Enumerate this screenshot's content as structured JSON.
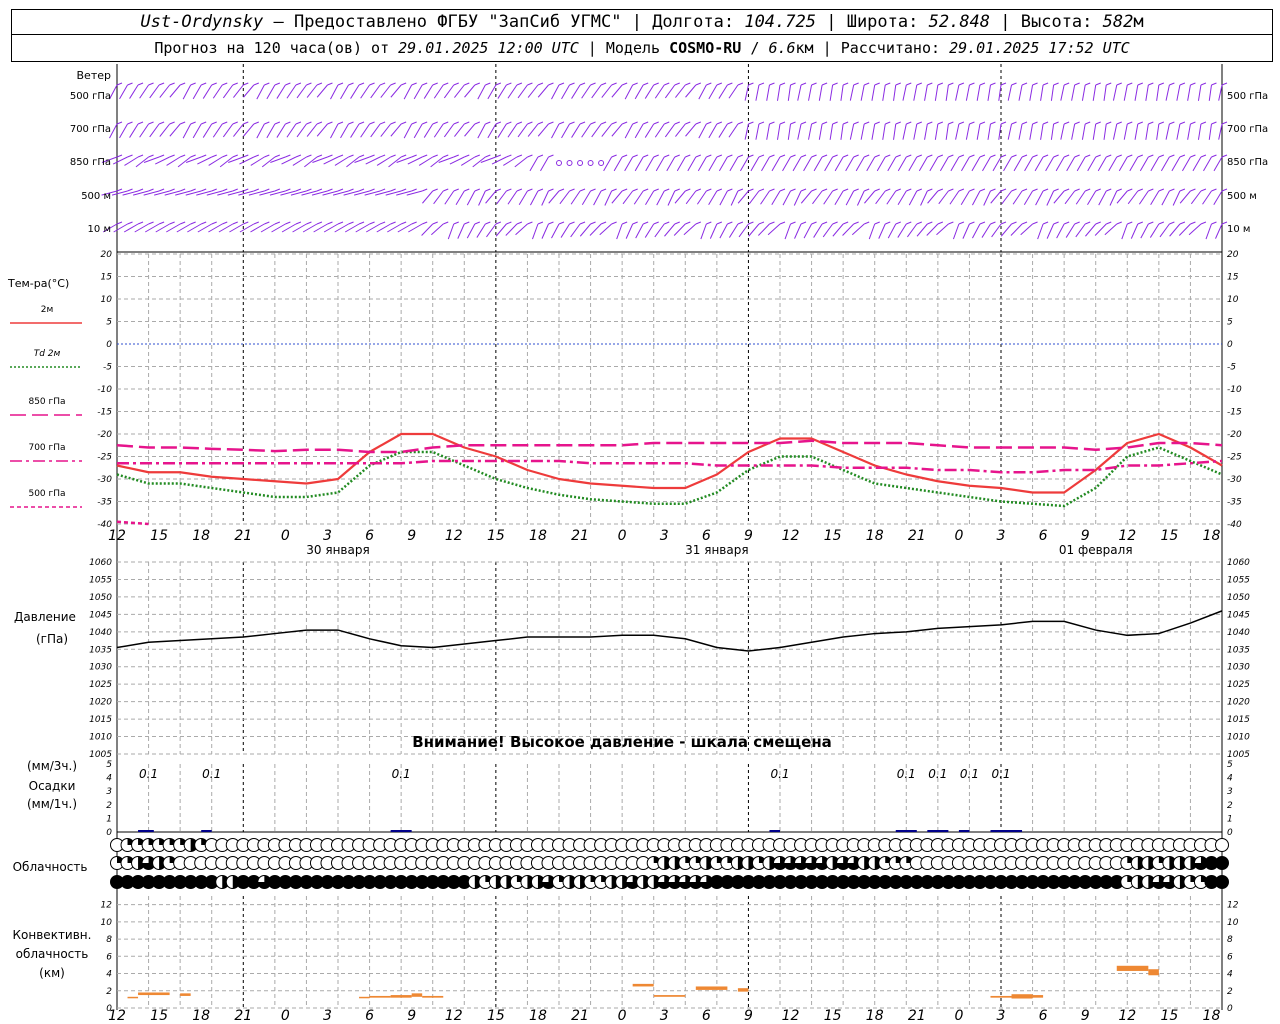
{
  "header": {
    "station": "Ust-Ordynsky",
    "dash": "—",
    "provider": "Предоставлено ФГБУ \"ЗапСиб УГМС\"",
    "lon_label": "Долгота:",
    "lon_value": "104.725",
    "lat_label": "Широта:",
    "lat_value": "52.848",
    "alt_label": "Высота:",
    "alt_value": "582",
    "alt_unit": "м",
    "forecast_prefix": "Прогноз на 120 часа(ов) от",
    "forecast_time": "29.01.2025 12:00 UTC",
    "model_label": "Модель",
    "model_name": "COSMO-RU",
    "model_res": "6.6",
    "model_res_unit": "км",
    "calc_label": "Рассчитано:",
    "calc_time": "29.01.2025 17:52 UTC"
  },
  "colors": {
    "wind": "#8a2be2",
    "t2m": "#ee3b3b",
    "td2m": "#228b22",
    "t850": "#e6148c",
    "pressure": "#000000",
    "precip": "#00008b",
    "conv": "#ee8833",
    "zero_line": "#2f4fcf",
    "grid": "#aaaaaa"
  },
  "time_axis": {
    "hour_labels": [
      "12",
      "15",
      "18",
      "21",
      "0",
      "3",
      "6",
      "9",
      "12",
      "15",
      "18",
      "21",
      "0",
      "3",
      "6",
      "9",
      "12",
      "15",
      "18",
      "21",
      "0",
      "3",
      "6",
      "9",
      "12",
      "15",
      "18"
    ],
    "day_labels": [
      {
        "text": "30 января",
        "hour": 21
      },
      {
        "text": "31 января",
        "hour": 57
      },
      {
        "text": "01 февраля",
        "hour": 93
      }
    ]
  },
  "wind_panel": {
    "title": "Ветер",
    "levels": [
      "500 гПа",
      "700 гПа",
      "850 гПа",
      "500 м",
      "10  м"
    ]
  },
  "chart_data": [
    {
      "type": "line",
      "name": "temperature",
      "label": "Тем-ра(°C)",
      "ylim": [
        -40,
        20
      ],
      "yticks": [
        20,
        15,
        10,
        5,
        0,
        -5,
        -10,
        -15,
        -20,
        -25,
        -30,
        -35,
        -40
      ],
      "x_hours": [
        0,
        3,
        6,
        9,
        12,
        15,
        18,
        21,
        24,
        27,
        30,
        33,
        36,
        39,
        42,
        45,
        48,
        51,
        54,
        57,
        60,
        63,
        66,
        69,
        72,
        75,
        78,
        81,
        84,
        87,
        90,
        93,
        96,
        99,
        102,
        105
      ],
      "series": [
        {
          "name": "2м",
          "style": "solid",
          "values": [
            -27,
            -28.5,
            -28.5,
            -29.5,
            -30,
            -30.5,
            -31,
            -30,
            -24,
            -20,
            -20,
            -23,
            -25,
            -28,
            -30,
            -31,
            -31.5,
            -32,
            -32,
            -29,
            -24,
            -21,
            -21,
            -24,
            -27,
            -29,
            -30.5,
            -31.5,
            -32,
            -33,
            -33,
            -28,
            -22,
            -20,
            -23,
            -27
          ]
        },
        {
          "name": "Td  2м",
          "style": "dotted",
          "values": [
            -29,
            -31,
            -31,
            -32,
            -33,
            -34,
            -34,
            -33,
            -27,
            -24,
            -24,
            -27,
            -30,
            -32,
            -33.5,
            -34.5,
            -35,
            -35.5,
            -35.5,
            -33,
            -28,
            -25,
            -25,
            -28,
            -31,
            -32,
            -33,
            -34,
            -35,
            -35.5,
            -36,
            -32,
            -25,
            -23,
            -26,
            -29
          ]
        },
        {
          "name": "850 гПа",
          "style": "dashed",
          "values": [
            -22.5,
            -23,
            -23,
            -23.3,
            -23.5,
            -23.8,
            -23.5,
            -23.5,
            -24,
            -24,
            -23,
            -22.5,
            -22.5,
            -22.5,
            -22.5,
            -22.5,
            -22.5,
            -22,
            -22,
            -22,
            -22,
            -22,
            -21.5,
            -22,
            -22,
            -22,
            -22.5,
            -23,
            -23,
            -23,
            -23,
            -23.5,
            -23,
            -22,
            -22,
            -22.5
          ]
        },
        {
          "name": "700 гПа",
          "style": "dashdot",
          "values": [
            -26.5,
            -26.5,
            -26.5,
            -26.5,
            -26.5,
            -26.5,
            -26.5,
            -26.5,
            -26.5,
            -26.5,
            -26,
            -26,
            -26,
            -26,
            -26,
            -26.5,
            -26.5,
            -26.5,
            -26.5,
            -27,
            -27,
            -27,
            -27,
            -27.5,
            -27.5,
            -27.5,
            -28,
            -28,
            -28.5,
            -28.5,
            -28,
            -28,
            -27,
            -27,
            -26.5,
            -26
          ]
        },
        {
          "name": "500 гПа",
          "style": "shortdash",
          "values": [
            -39.5,
            -40
          ]
        }
      ]
    },
    {
      "type": "line",
      "name": "pressure",
      "label": "Давление",
      "unit_label": "(гПа)",
      "ylim": [
        1005,
        1060
      ],
      "yticks": [
        1060,
        1055,
        1050,
        1045,
        1040,
        1035,
        1030,
        1025,
        1020,
        1015,
        1010,
        1005
      ],
      "note": "Внимание! Высокое давление - шкала смещена",
      "x_hours": [
        0,
        3,
        6,
        9,
        12,
        15,
        18,
        21,
        24,
        27,
        30,
        33,
        36,
        39,
        42,
        45,
        48,
        51,
        54,
        57,
        60,
        63,
        66,
        69,
        72,
        75,
        78,
        81,
        84,
        87,
        90,
        93,
        96,
        99,
        102,
        105
      ],
      "series": [
        {
          "name": "pressure",
          "values": [
            1035.5,
            1037,
            1037.5,
            1038,
            1038.5,
            1039.5,
            1040.5,
            1040.5,
            1038,
            1036,
            1035.5,
            1036.5,
            1037.5,
            1038.5,
            1038.5,
            1038.5,
            1039,
            1039,
            1038,
            1035.5,
            1034.5,
            1035.5,
            1037,
            1038.5,
            1039.5,
            1040,
            1041,
            1041.5,
            1042,
            1043,
            1043,
            1040.5,
            1039,
            1039.5,
            1042.5,
            1046
          ]
        }
      ]
    },
    {
      "type": "bar",
      "name": "precipitation",
      "label_top": "(мм/3ч.)",
      "label_mid": "Осадки",
      "label_bot": "(мм/1ч.)",
      "ylim": [
        0,
        5
      ],
      "yticks": [
        5,
        4,
        3,
        2,
        1,
        0
      ],
      "totals_3h": [
        {
          "hour": 3,
          "value": "0.1"
        },
        {
          "hour": 9,
          "value": "0.1"
        },
        {
          "hour": 27,
          "value": "0.1"
        },
        {
          "hour": 63,
          "value": "0.1"
        },
        {
          "hour": 75,
          "value": "0.1"
        },
        {
          "hour": 78,
          "value": "0.1"
        },
        {
          "hour": 81,
          "value": "0.1"
        },
        {
          "hour": 84,
          "value": "0.1"
        }
      ],
      "hourly_bars": [
        {
          "start": 2,
          "end": 3.5,
          "value": 0.05
        },
        {
          "start": 8,
          "end": 9,
          "value": 0.05
        },
        {
          "start": 26,
          "end": 28,
          "value": 0.05
        },
        {
          "start": 62,
          "end": 63,
          "value": 0.05
        },
        {
          "start": 74,
          "end": 76,
          "value": 0.05
        },
        {
          "start": 77,
          "end": 79,
          "value": 0.05
        },
        {
          "start": 80,
          "end": 81,
          "value": 0.05
        },
        {
          "start": 83,
          "end": 86,
          "value": 0.05
        }
      ]
    },
    {
      "type": "table",
      "name": "cloudiness",
      "label": "Облачность",
      "rows": [
        {
          "level": "high",
          "values": [
            0,
            1,
            1,
            1,
            1,
            1,
            1,
            2,
            1,
            0,
            0,
            0,
            0,
            0,
            0,
            0,
            0,
            0,
            0,
            0,
            0,
            0,
            0,
            0,
            0,
            0,
            0,
            0,
            0,
            0,
            0,
            0,
            0,
            0,
            0,
            0,
            0,
            0,
            0,
            0,
            0,
            0,
            0,
            0,
            0,
            0,
            0,
            0,
            0,
            0,
            0,
            0,
            0,
            0,
            0,
            0,
            0,
            0,
            0,
            0,
            0,
            0,
            0,
            0,
            0,
            0,
            0,
            0,
            0,
            0,
            0,
            0,
            0,
            0,
            0,
            0,
            0,
            0,
            0,
            0,
            0,
            0,
            0,
            0,
            0,
            0,
            0,
            0,
            0,
            0,
            0,
            0,
            0,
            0,
            0,
            0,
            0,
            0,
            0,
            0,
            0,
            0,
            0,
            0,
            0,
            0
          ]
        },
        {
          "level": "middle",
          "values": [
            1,
            1,
            2,
            3,
            2,
            1,
            0,
            0,
            0,
            0,
            0,
            0,
            0,
            0,
            0,
            0,
            0,
            0,
            0,
            0,
            0,
            0,
            0,
            0,
            0,
            0,
            0,
            0,
            0,
            0,
            0,
            0,
            0,
            0,
            0,
            0,
            0,
            0,
            0,
            0,
            0,
            0,
            0,
            0,
            0,
            0,
            0,
            0,
            0,
            0,
            0,
            1,
            2,
            2,
            1,
            1,
            2,
            1,
            1,
            2,
            2,
            1,
            2,
            3,
            3,
            3,
            3,
            3,
            2,
            3,
            3,
            2,
            2,
            1,
            1,
            1,
            0,
            0,
            0,
            0,
            0,
            0,
            0,
            0,
            0,
            0,
            0,
            0,
            0,
            0,
            0,
            0,
            0,
            0,
            0,
            0,
            1,
            2,
            2,
            1,
            2,
            2,
            2,
            3,
            4,
            4
          ]
        },
        {
          "level": "low",
          "values": [
            4,
            4,
            4,
            4,
            4,
            4,
            4,
            4,
            4,
            4,
            2,
            2,
            4,
            4,
            3,
            4,
            4,
            4,
            4,
            4,
            4,
            4,
            4,
            4,
            4,
            4,
            4,
            4,
            4,
            4,
            4,
            4,
            4,
            4,
            2,
            1,
            2,
            2,
            1,
            2,
            2,
            3,
            1,
            2,
            2,
            1,
            1,
            2,
            2,
            3,
            2,
            2,
            3,
            3,
            3,
            3,
            3,
            4,
            4,
            4,
            4,
            4,
            4,
            4,
            4,
            4,
            4,
            4,
            4,
            4,
            4,
            4,
            4,
            4,
            4,
            4,
            4,
            4,
            4,
            4,
            4,
            4,
            4,
            4,
            4,
            4,
            4,
            4,
            4,
            4,
            4,
            4,
            4,
            4,
            4,
            4,
            1,
            2,
            2,
            3,
            3,
            2,
            1,
            1,
            4,
            4
          ]
        }
      ]
    },
    {
      "type": "bar",
      "name": "convective_cloudiness",
      "label_lines": [
        "Конвективн.",
        "облачность",
        "(км)"
      ],
      "ylim": [
        0,
        13
      ],
      "yticks": [
        12,
        10,
        8,
        6,
        4,
        2,
        0
      ],
      "segments": [
        {
          "start": 1,
          "end": 2,
          "base": 1.2,
          "top": 1.3
        },
        {
          "start": 2,
          "end": 5,
          "base": 1.5,
          "top": 1.8
        },
        {
          "start": 6,
          "end": 7,
          "base": 1.4,
          "top": 1.7
        },
        {
          "start": 23,
          "end": 24,
          "base": 1.2,
          "top": 1.3
        },
        {
          "start": 24,
          "end": 26,
          "base": 1.2,
          "top": 1.4
        },
        {
          "start": 26,
          "end": 28,
          "base": 1.2,
          "top": 1.5
        },
        {
          "start": 28,
          "end": 29,
          "base": 1.3,
          "top": 1.7
        },
        {
          "start": 29,
          "end": 31,
          "base": 1.2,
          "top": 1.4
        },
        {
          "start": 49,
          "end": 51,
          "base": 2.5,
          "top": 2.8
        },
        {
          "start": 51,
          "end": 54,
          "base": 1.3,
          "top": 1.5
        },
        {
          "start": 55,
          "end": 58,
          "base": 2.1,
          "top": 2.5
        },
        {
          "start": 59,
          "end": 60,
          "base": 1.9,
          "top": 2.3
        },
        {
          "start": 83,
          "end": 85,
          "base": 1.2,
          "top": 1.4
        },
        {
          "start": 85,
          "end": 87,
          "base": 1.1,
          "top": 1.6
        },
        {
          "start": 87,
          "end": 88,
          "base": 1.2,
          "top": 1.5
        },
        {
          "start": 95,
          "end": 98,
          "base": 4.3,
          "top": 4.9
        },
        {
          "start": 98,
          "end": 99,
          "base": 3.8,
          "top": 4.5
        }
      ]
    }
  ]
}
